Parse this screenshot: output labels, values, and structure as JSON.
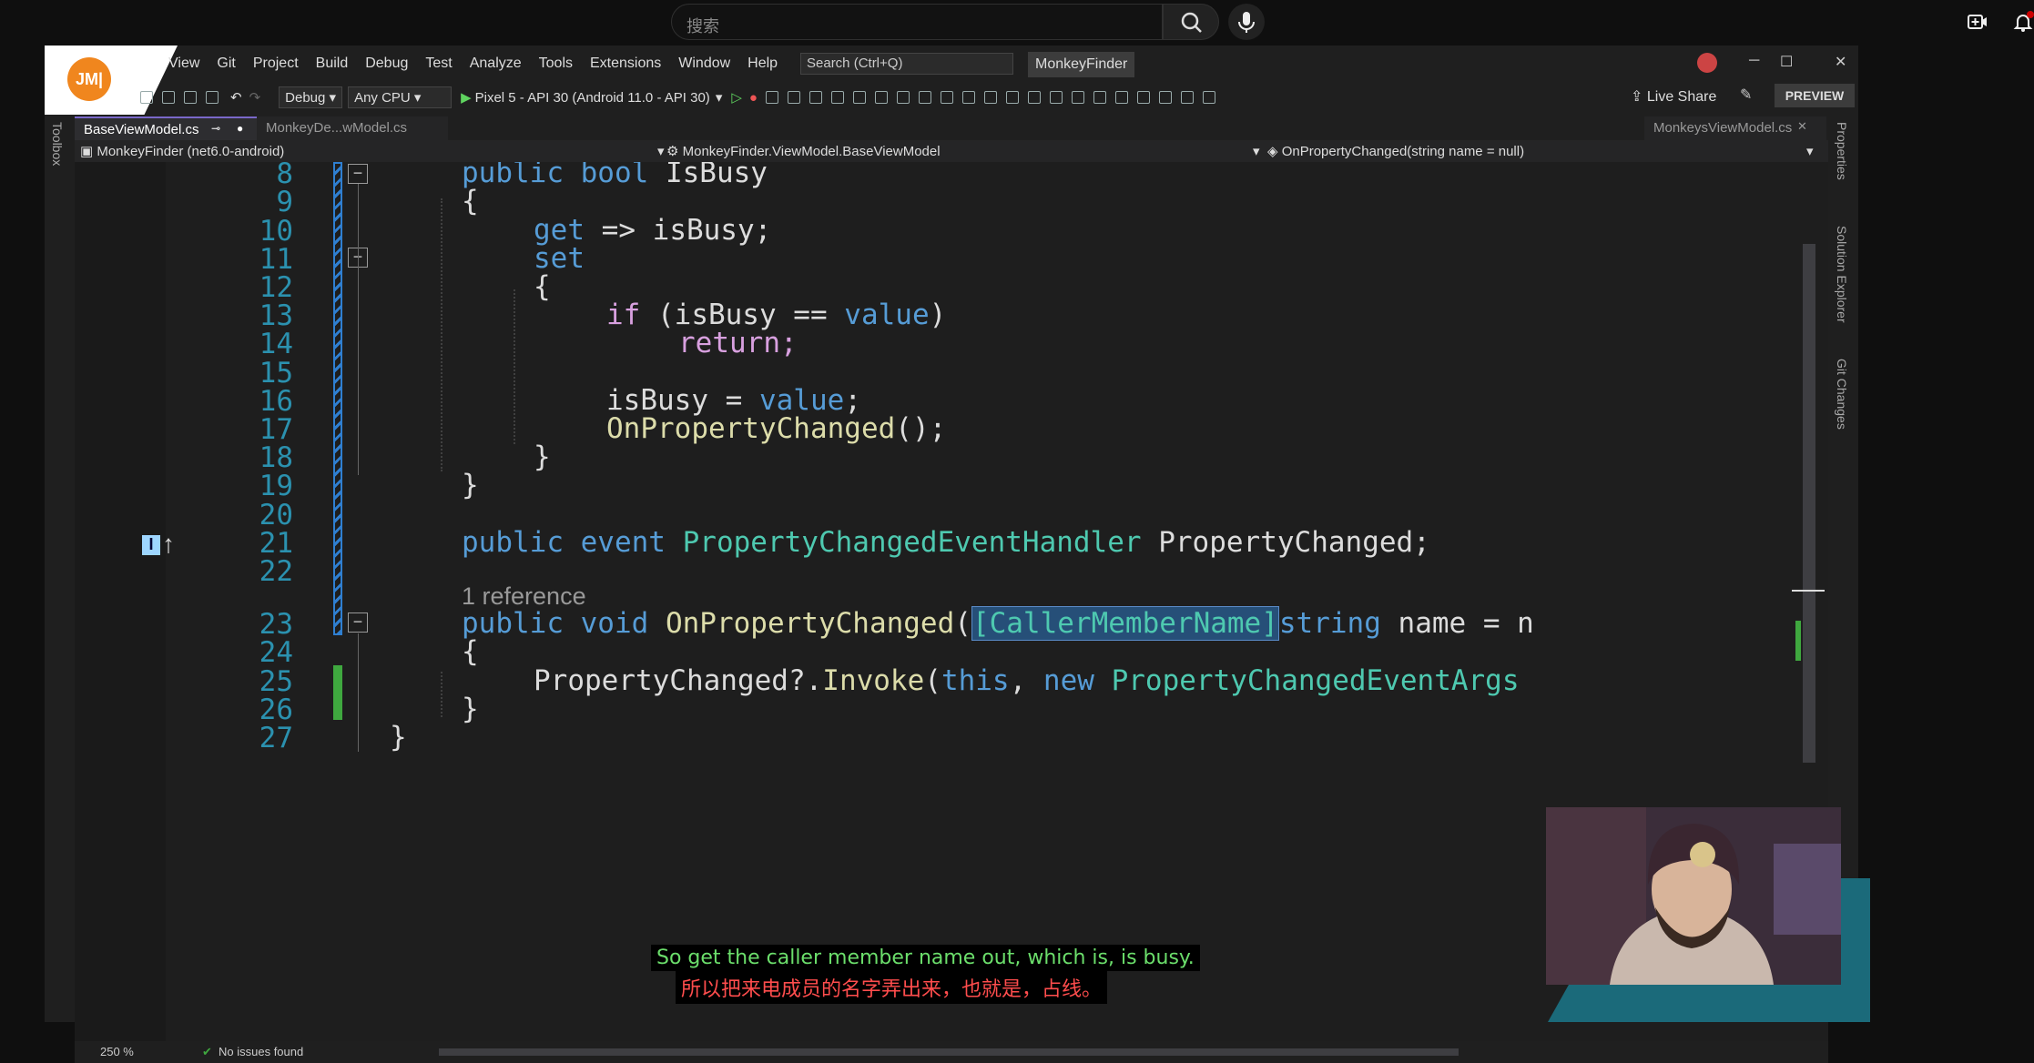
{
  "browser": {
    "search_placeholder": "搜索"
  },
  "vs": {
    "logo": "JM|",
    "menu": [
      "View",
      "Git",
      "Project",
      "Build",
      "Debug",
      "Test",
      "Analyze",
      "Tools",
      "Extensions",
      "Window",
      "Help"
    ],
    "search_placeholder": "Search (Ctrl+Q)",
    "solution_name": "MonkeyFinder",
    "toolbar": {
      "config": "Debug",
      "platform": "Any CPU",
      "run_target": "Pixel 5 - API 30 (Android 11.0 - API 30)",
      "live_share": "Live Share",
      "preview": "PREVIEW"
    },
    "left_rail": "Toolbox",
    "right_rail": [
      "Properties",
      "Solution Explorer",
      "Git Changes"
    ],
    "tabs": {
      "active": "BaseViewModel.cs",
      "second": "MonkeyDe...wModel.cs",
      "right": "MonkeysViewModel.cs"
    },
    "navbar": {
      "project": "MonkeyFinder (net6.0-android)",
      "type": "MonkeyFinder.ViewModel.BaseViewModel",
      "member": "OnPropertyChanged(string name = null)"
    },
    "status": {
      "zoom": "250 %",
      "issues": "No issues found"
    }
  },
  "code": {
    "line_numbers": [
      "8",
      "9",
      "10",
      "11",
      "12",
      "13",
      "14",
      "15",
      "16",
      "17",
      "18",
      "19",
      "20",
      "21",
      "22",
      "23",
      "24",
      "25",
      "26",
      "27"
    ],
    "codelens": "1 reference",
    "lines": {
      "l8a": "public bool",
      "l8b": " IsBusy",
      "l9": "{",
      "l10a": "get",
      "l10b": " => isBusy;",
      "l11": "set",
      "l12": "{",
      "l13a": "if",
      "l13b": " (isBusy == ",
      "l13c": "value",
      "l13d": ")",
      "l14": "return;",
      "l16a": "isBusy = ",
      "l16b": "value",
      "l16c": ";",
      "l17a": "OnPropertyChanged",
      "l17b": "();",
      "l18": "}",
      "l19": "}",
      "l21a": "public event",
      "l21b": " PropertyChangedEventHandler",
      "l21c": " PropertyChanged;",
      "l23a": "public void",
      "l23b": " OnPropertyChanged",
      "l23c": "(",
      "l23d": "[CallerMemberName]",
      "l23e": "string",
      "l23f": " name = n",
      "l24": "{",
      "l25a": "PropertyChanged?.",
      "l25b": "Invoke",
      "l25c": "(",
      "l25d": "this",
      "l25e": ", ",
      "l25f": "new",
      "l25g": " PropertyChangedEventArgs",
      "l26": "}",
      "l27": "}"
    }
  },
  "subtitles": {
    "english": "So get the caller member name out, which is, is busy.",
    "chinese": "所以把来电成员的名字弄出来，也就是，占线。"
  },
  "colors": {
    "english_subtitle": "#6bde6b",
    "chinese_subtitle": "#ff4d4d",
    "accent": "#7a68c9"
  }
}
